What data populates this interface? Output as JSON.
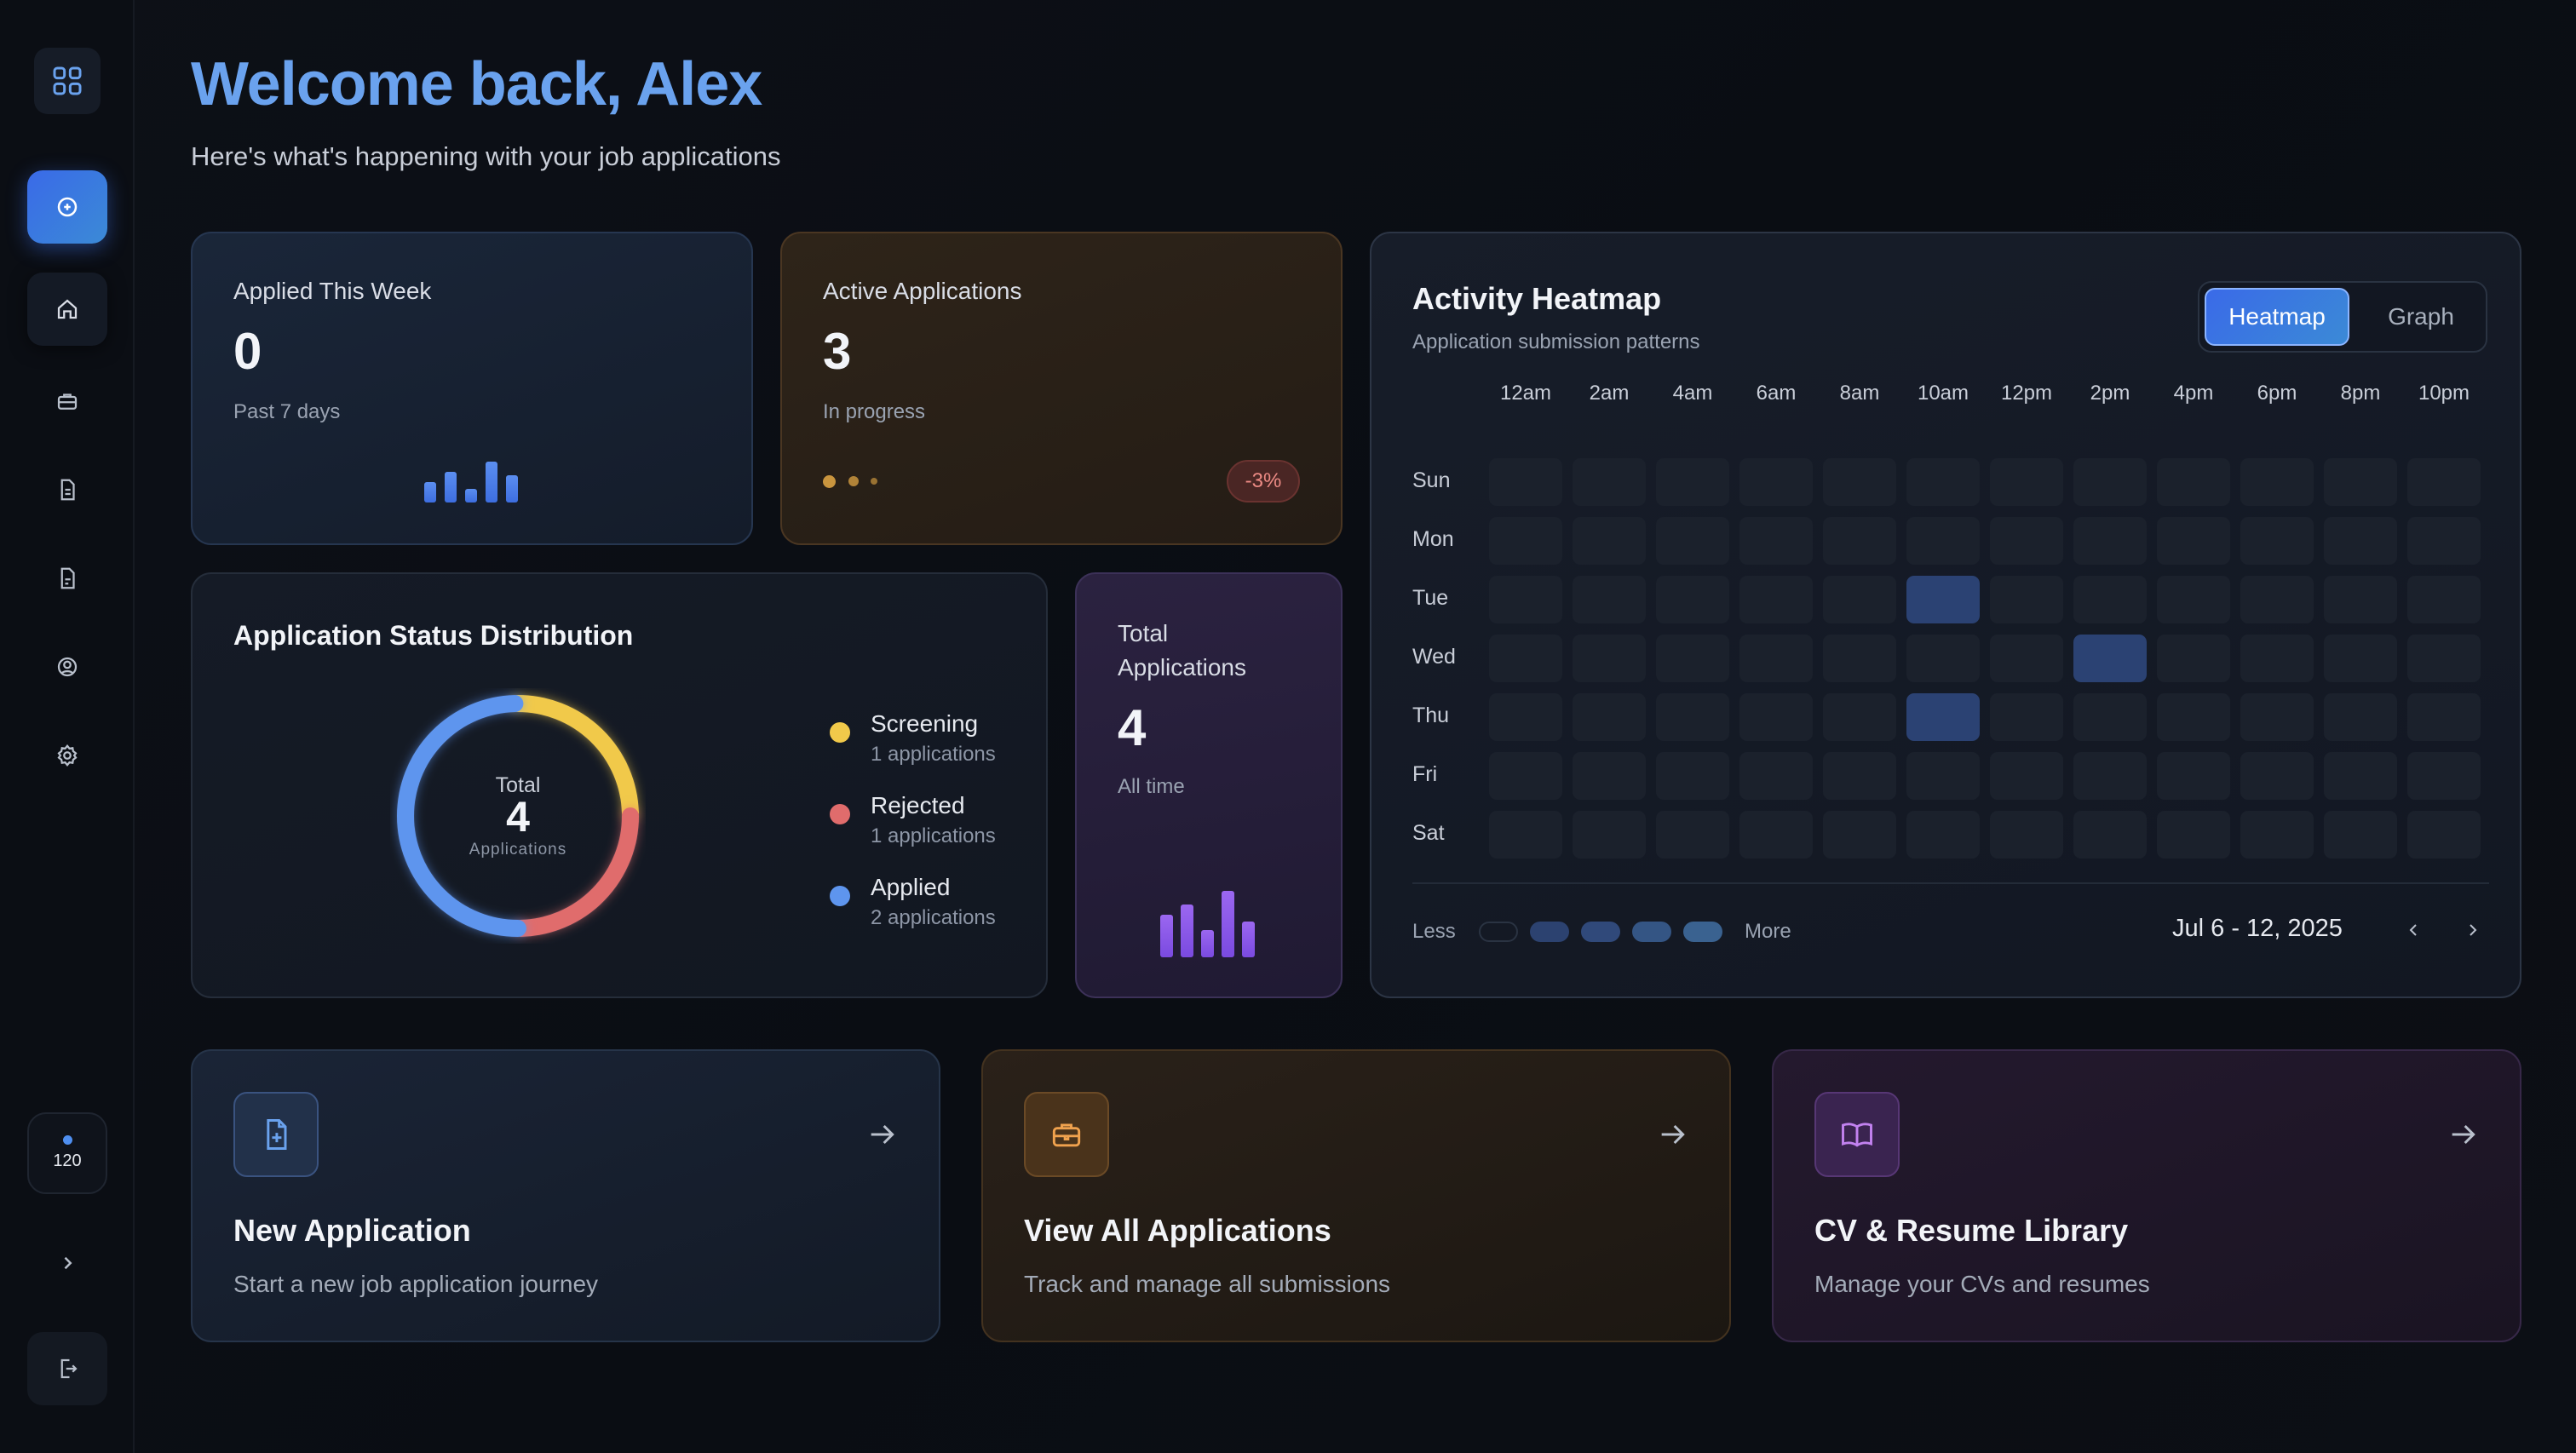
{
  "header": {
    "title": "Welcome back, Alex",
    "subtitle": "Here's what's happening with your job applications"
  },
  "sidebar": {
    "items": [
      {
        "name": "grid-icon"
      },
      {
        "name": "add-circle-icon"
      },
      {
        "name": "home-icon"
      },
      {
        "name": "briefcase-icon"
      },
      {
        "name": "document-icon"
      },
      {
        "name": "file-icon"
      },
      {
        "name": "user-circle-icon"
      },
      {
        "name": "settings-icon"
      }
    ],
    "badge_count": "120"
  },
  "stats": {
    "applied_week": {
      "label": "Applied This Week",
      "value": "0",
      "sub": "Past 7 days"
    },
    "active": {
      "label": "Active Applications",
      "value": "3",
      "sub": "In progress",
      "change": "-3%"
    },
    "total": {
      "label": "Total Applications",
      "value": "4",
      "sub": "All time"
    }
  },
  "status_distribution": {
    "title": "Application Status Distribution",
    "center_label": "Total",
    "center_value": "4",
    "center_sub": "Applications",
    "items": [
      {
        "name": "Screening",
        "count": "1 applications",
        "value": 1,
        "color": "#f1c94a"
      },
      {
        "name": "Rejected",
        "count": "1 applications",
        "value": 1,
        "color": "#e06c6c"
      },
      {
        "name": "Applied",
        "count": "2 applications",
        "value": 2,
        "color": "#5e95ee"
      }
    ]
  },
  "heatmap": {
    "title": "Activity Heatmap",
    "subtitle": "Application submission patterns",
    "toggle": {
      "active": "Heatmap",
      "other": "Graph"
    },
    "hours": [
      "12am",
      "2am",
      "4am",
      "6am",
      "8am",
      "10am",
      "12pm",
      "2pm",
      "4pm",
      "6pm",
      "8pm",
      "10pm"
    ],
    "days": [
      "Sun",
      "Mon",
      "Tue",
      "Wed",
      "Thu",
      "Fri",
      "Sat"
    ],
    "active_cells": [
      {
        "day": "Tue",
        "hour": "10am"
      },
      {
        "day": "Wed",
        "hour": "2pm"
      },
      {
        "day": "Thu",
        "hour": "10am"
      }
    ],
    "legend_less": "Less",
    "legend_more": "More",
    "date_range": "Jul 6 - 12, 2025"
  },
  "actions": [
    {
      "title": "New Application",
      "desc": "Start a new job application journey",
      "icon": "file-plus-icon"
    },
    {
      "title": "View All Applications",
      "desc": "Track and manage all submissions",
      "icon": "briefcase-icon"
    },
    {
      "title": "CV & Resume Library",
      "desc": "Manage your CVs and resumes",
      "icon": "book-open-icon"
    }
  ]
}
